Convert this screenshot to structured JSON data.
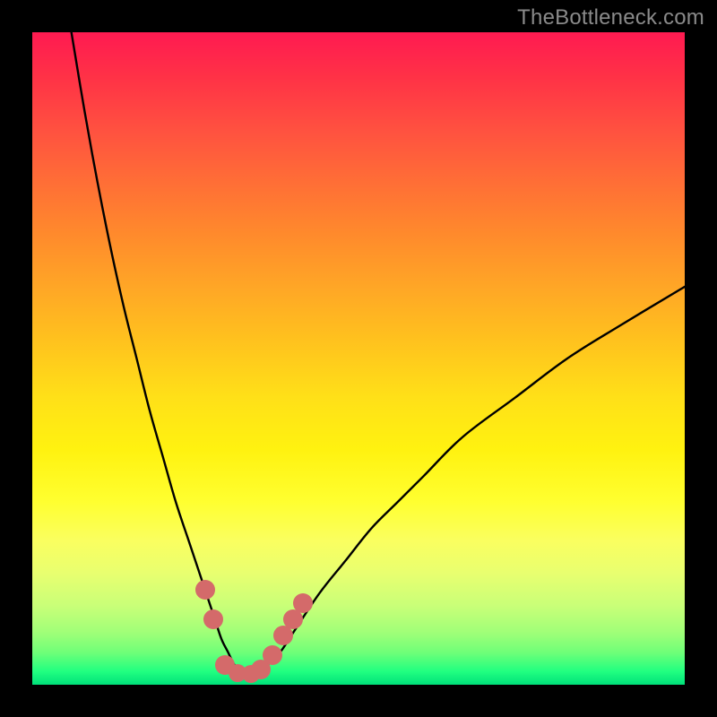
{
  "watermark": "TheBottleneck.com",
  "colors": {
    "page_bg": "#000000",
    "watermark_text": "#8a8a8a",
    "curve_stroke": "#000000",
    "marker_fill": "#d46a6a",
    "gradient_stops": [
      "#ff1a51",
      "#ff3246",
      "#ff5140",
      "#ff6e36",
      "#ff8a2c",
      "#ffa626",
      "#ffc11e",
      "#ffe018",
      "#fff210",
      "#ffff30",
      "#faff60",
      "#e8ff70",
      "#c8ff78",
      "#a0ff78",
      "#70ff78",
      "#20ff80",
      "#00e07a"
    ]
  },
  "chart_data": {
    "type": "line",
    "title": "",
    "xlabel": "",
    "ylabel": "",
    "xlim": [
      0,
      100
    ],
    "ylim": [
      0,
      100
    ],
    "series": [
      {
        "name": "bottleneck-curve",
        "x": [
          6,
          8,
          10,
          12,
          14,
          16,
          18,
          20,
          22,
          24,
          26,
          27,
          28,
          29,
          30,
          31,
          32,
          33,
          34,
          35,
          36,
          38,
          40,
          44,
          48,
          52,
          56,
          60,
          66,
          74,
          82,
          90,
          100
        ],
        "y": [
          100,
          88,
          77,
          67,
          58,
          50,
          42,
          35,
          28,
          22,
          16,
          13,
          10,
          7,
          5,
          3,
          2,
          1.5,
          1.6,
          2,
          3,
          5,
          8,
          14,
          19,
          24,
          28,
          32,
          38,
          44,
          50,
          55,
          61
        ]
      }
    ],
    "markers": [
      {
        "x": 26.5,
        "y": 14.5,
        "r": 11
      },
      {
        "x": 27.8,
        "y": 10.0,
        "r": 11
      },
      {
        "x": 29.5,
        "y": 3.0,
        "r": 11
      },
      {
        "x": 31.5,
        "y": 1.8,
        "r": 10
      },
      {
        "x": 33.5,
        "y": 1.6,
        "r": 10
      },
      {
        "x": 35.0,
        "y": 2.3,
        "r": 11
      },
      {
        "x": 36.8,
        "y": 4.5,
        "r": 11
      },
      {
        "x": 38.5,
        "y": 7.5,
        "r": 11
      },
      {
        "x": 40.0,
        "y": 10.0,
        "r": 11
      },
      {
        "x": 41.5,
        "y": 12.5,
        "r": 11
      }
    ]
  }
}
